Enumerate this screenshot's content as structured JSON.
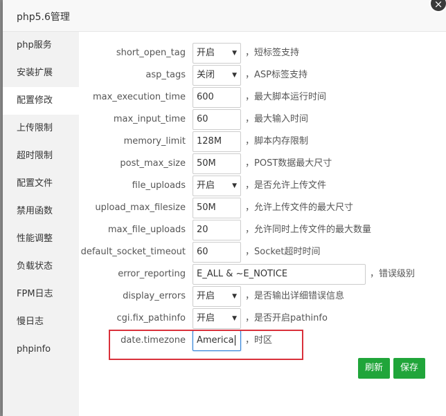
{
  "dialog": {
    "title": "php5.6管理",
    "close_glyph": "×"
  },
  "sidebar": {
    "items": [
      {
        "label": "php服务"
      },
      {
        "label": "安装扩展"
      },
      {
        "label": "配置修改"
      },
      {
        "label": "上传限制"
      },
      {
        "label": "超时限制"
      },
      {
        "label": "配置文件"
      },
      {
        "label": "禁用函数"
      },
      {
        "label": "性能调整"
      },
      {
        "label": "负载状态"
      },
      {
        "label": "FPM日志"
      },
      {
        "label": "慢日志"
      },
      {
        "label": "phpinfo"
      }
    ],
    "active": "配置修改"
  },
  "config": [
    {
      "name": "short_open_tag",
      "type": "select",
      "value": "开启",
      "desc": "，短标签支持"
    },
    {
      "name": "asp_tags",
      "type": "select",
      "value": "关闭",
      "desc": "，ASP标签支持"
    },
    {
      "name": "max_execution_time",
      "type": "input",
      "value": "600",
      "desc": "，最大脚本运行时间"
    },
    {
      "name": "max_input_time",
      "type": "input",
      "value": "60",
      "desc": "，最大输入时间"
    },
    {
      "name": "memory_limit",
      "type": "input",
      "value": "128M",
      "desc": "，脚本内存限制"
    },
    {
      "name": "post_max_size",
      "type": "input",
      "value": "50M",
      "desc": "，POST数据最大尺寸"
    },
    {
      "name": "file_uploads",
      "type": "select",
      "value": "开启",
      "desc": "，是否允许上传文件"
    },
    {
      "name": "upload_max_filesize",
      "type": "input",
      "value": "50M",
      "desc": "，允许上传文件的最大尺寸"
    },
    {
      "name": "max_file_uploads",
      "type": "input",
      "value": "20",
      "desc": "，允许同时上传文件的最大数量"
    },
    {
      "name": "default_socket_timeout",
      "type": "input",
      "value": "60",
      "desc": "，Socket超时时间"
    },
    {
      "name": "error_reporting",
      "type": "input",
      "value": "E_ALL & ~E_NOTICE",
      "desc": "，错误级别"
    },
    {
      "name": "display_errors",
      "type": "select",
      "value": "开启",
      "desc": "，是否输出详细错误信息"
    },
    {
      "name": "cgi.fix_pathinfo",
      "type": "select",
      "value": "开启",
      "desc": "，是否开启pathinfo"
    },
    {
      "name": "date.timezone",
      "type": "input",
      "value": "America",
      "desc": "，时区"
    }
  ],
  "select_arrow": "▼",
  "buttons": {
    "refresh": "刷新",
    "save": "保存"
  },
  "colors": {
    "accent": "#20a53a",
    "highlight": "#d9303a"
  }
}
